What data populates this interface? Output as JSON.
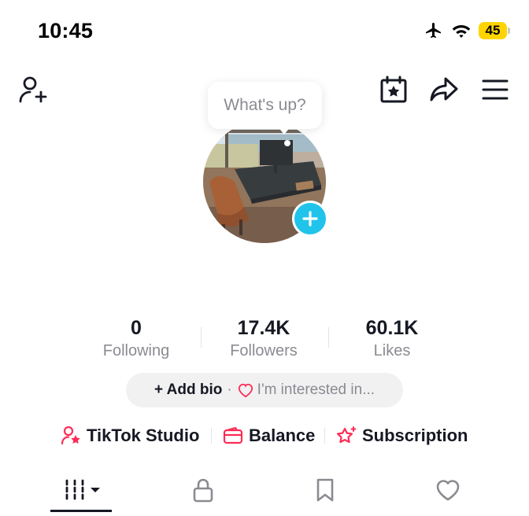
{
  "status_bar": {
    "time": "10:45",
    "battery": "45",
    "icons": [
      "airplane-icon",
      "wifi-icon",
      "battery-icon"
    ],
    "battery_color": "#ffd400"
  },
  "header": {
    "left_icon": "add-friend-icon",
    "right_icons": [
      "calendar-star-icon",
      "share-icon",
      "menu-icon"
    ]
  },
  "profile": {
    "bubble_text": "What's up?",
    "avatar_icon": "avatar-photo",
    "add_icon": "plus-icon",
    "accent": "#20c4ea"
  },
  "stats": [
    {
      "value": "0",
      "label": "Following"
    },
    {
      "value": "17.4K",
      "label": "Followers"
    },
    {
      "value": "60.1K",
      "label": "Likes"
    }
  ],
  "bio": {
    "add_label": "+ Add bio",
    "separator": "·",
    "interest_label": "I'm interested in...",
    "interest_icon": "heart-outline-icon",
    "accent": "#fe2c55"
  },
  "tools": [
    {
      "label": "TikTok Studio",
      "icon": "creator-star-icon"
    },
    {
      "label": "Balance",
      "icon": "wallet-icon"
    },
    {
      "label": "Subscription",
      "icon": "star-sparkle-icon"
    }
  ],
  "tabs": [
    {
      "name": "videos",
      "icon": "grid-bars-icon",
      "has_dropdown": true,
      "active": true
    },
    {
      "name": "private",
      "icon": "lock-icon",
      "active": false
    },
    {
      "name": "saved",
      "icon": "bookmark-icon",
      "active": false
    },
    {
      "name": "liked",
      "icon": "heart-icon",
      "active": false
    }
  ]
}
